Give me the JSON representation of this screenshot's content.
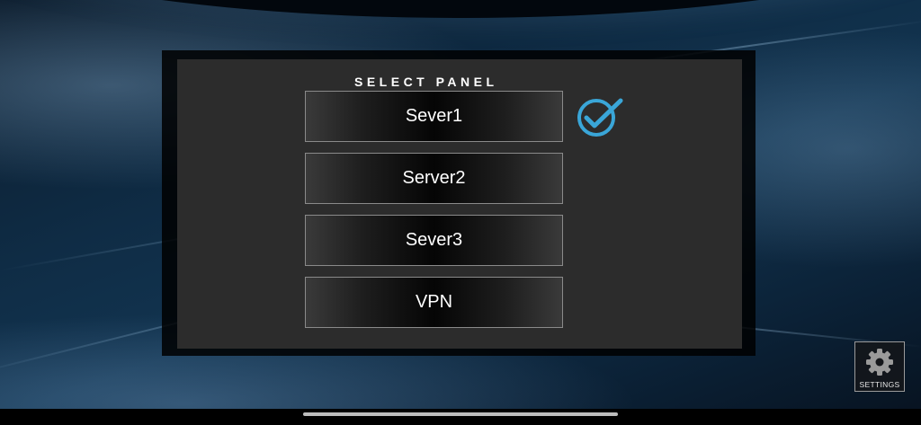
{
  "panel": {
    "title": "SELECT PANEL",
    "servers": [
      {
        "label": "Sever1",
        "selected": true
      },
      {
        "label": "Server2",
        "selected": false
      },
      {
        "label": "Sever3",
        "selected": false
      },
      {
        "label": "VPN",
        "selected": false
      }
    ]
  },
  "settings": {
    "label": "SETTINGS",
    "icon": "gear-icon"
  },
  "colors": {
    "check_accent": "#3aa6d8",
    "panel_bg": "#2c2c2c"
  }
}
